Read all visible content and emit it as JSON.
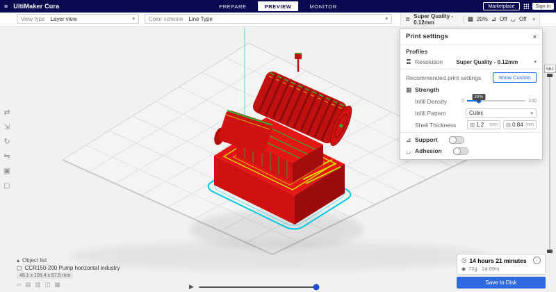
{
  "topbar": {
    "app_title": "UltiMaker Cura",
    "tabs": [
      {
        "label": "PREPARE"
      },
      {
        "label": "PREVIEW"
      },
      {
        "label": "MONITOR"
      }
    ],
    "marketplace_label": "Marketplace",
    "signin_label": "Sign in"
  },
  "viewbar": {
    "view_type_label": "View type",
    "view_type_value": "Layer view",
    "color_scheme_label": "Color scheme",
    "color_scheme_value": "Line Type"
  },
  "setup_summary": {
    "profile": "Super Quality - 0.12mm",
    "infill": "20%",
    "support": "Off",
    "adhesion": "Off"
  },
  "panel": {
    "title": "Print settings",
    "profiles_title": "Profiles",
    "resolution_label": "Resolution",
    "resolution_value": "Super Quality - 0.12mm",
    "recommended_label": "Recommended print settings",
    "show_custom_label": "Show Custom",
    "strength_label": "Strength",
    "infill_density_label": "Infill Density",
    "slider_min": "0",
    "slider_max": "100",
    "slider_tooltip": "20%",
    "infill_pattern_label": "Infill Pattern",
    "infill_pattern_value": "Cubic",
    "shell_label": "Shell Thickness",
    "shell_wall_value": "1.2",
    "shell_wall_unit": "mm",
    "shell_top_value": "0.84",
    "shell_top_unit": "mm",
    "support_label": "Support",
    "adhesion_label": "Adhesion"
  },
  "scene": {
    "layer_count": "562"
  },
  "object_list": {
    "header": "Object list",
    "model_name": "CCR150-200 Pump horizontal industry",
    "dimensions": "46.1 x 105.4 x 67.5 mm",
    "action_icons": [
      {
        "glyph": "▱"
      },
      {
        "glyph": "▤"
      },
      {
        "glyph": "▥"
      },
      {
        "glyph": "◫"
      },
      {
        "glyph": "▦"
      }
    ]
  },
  "job": {
    "time": "14 hours 21 minutes",
    "material": "72g · 24.09m",
    "save_label": "Save to Disk"
  },
  "tools": {
    "items": [
      {
        "name": "move",
        "glyph": "⇄"
      },
      {
        "name": "scale",
        "glyph": "⇲"
      },
      {
        "name": "rotate",
        "glyph": "↻"
      },
      {
        "name": "mirror",
        "glyph": "⇋"
      },
      {
        "name": "per-model-settings",
        "glyph": "▣"
      },
      {
        "name": "support-blocker",
        "glyph": "◻"
      }
    ]
  },
  "icons": {
    "hamburger": "≡",
    "chevron_down": "▾",
    "close": "×",
    "caret_up": "▴",
    "play": "▶",
    "clock": "◷",
    "spool": "◉",
    "cube": "▢",
    "quality": "≣",
    "infill": "▩",
    "support": "⊿",
    "adhesion": "◡",
    "strength": "▦",
    "wall": "▥",
    "top_bottom": "▤",
    "info": "i"
  },
  "colors": {
    "topbar": "#0a0850",
    "accent": "#196ef0",
    "save_button": "#2f6bdf",
    "model_shell_red": "#d51111",
    "model_skin_yellow": "#d8d800",
    "model_top_green": "#2db32d",
    "brim_cyan": "#00c9e2",
    "build_volume_edge": "#43c8de"
  }
}
